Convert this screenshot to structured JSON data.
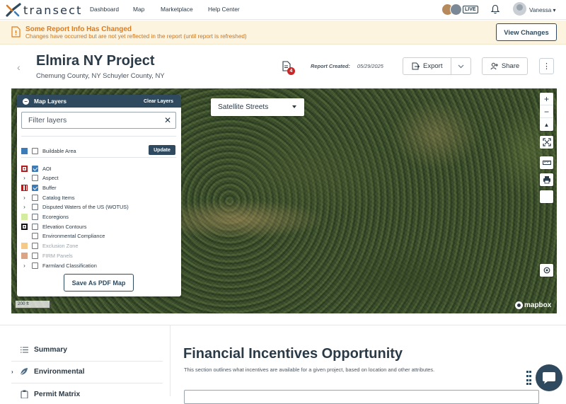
{
  "app": {
    "logo_text": "transect",
    "nav": [
      "Dashboard",
      "Map",
      "Marketplace",
      "Help Center"
    ],
    "live_label": "LIVE",
    "user_name": "Vanessa",
    "user_caret": "▾"
  },
  "banner": {
    "title": "Some Report Info Has Changed",
    "subtitle": "Changes have occurred but are not yet reflected in the report (until report is refreshed)",
    "button": "View Changes",
    "color": "#e07b1a"
  },
  "project": {
    "title": "Elmira NY Project",
    "counties": "Chemung County, NY Schuyler County, NY",
    "doc_badge": "4",
    "report_created_label": "Report Created:",
    "report_created_date": "05/29/2025",
    "export_label": "Export",
    "share_label": "Share",
    "more_label": "⋮"
  },
  "map": {
    "panel_title": "Map Layers",
    "clear_layers": "Clear Layers",
    "filter_placeholder": "Filter layers",
    "buildable_area": "Buildable Area",
    "update_label": "Update",
    "layers": [
      {
        "label": "AOI",
        "checked": true,
        "expandable": false,
        "swatch": "aoi",
        "faded": false
      },
      {
        "label": "Aspect",
        "checked": false,
        "expandable": true,
        "swatch": "",
        "faded": false
      },
      {
        "label": "Buffer",
        "checked": true,
        "expandable": false,
        "swatch": "buffer",
        "faded": false
      },
      {
        "label": "Catalog Items",
        "checked": false,
        "expandable": true,
        "swatch": "",
        "faded": false
      },
      {
        "label": "Disputed Waters of the US (WOTUS)",
        "checked": false,
        "expandable": true,
        "swatch": "",
        "faded": false
      },
      {
        "label": "Ecoregions",
        "checked": false,
        "expandable": false,
        "swatch": "eco",
        "faded": false
      },
      {
        "label": "Elevation Contours",
        "checked": false,
        "expandable": false,
        "swatch": "elev",
        "faded": false
      },
      {
        "label": "Environmental Compliance",
        "checked": false,
        "expandable": false,
        "swatch": "",
        "faded": false
      },
      {
        "label": "Exclusion Zone",
        "checked": false,
        "expandable": false,
        "swatch": "excl",
        "faded": true
      },
      {
        "label": "FIRM Panels",
        "checked": false,
        "expandable": false,
        "swatch": "firm",
        "faded": true
      },
      {
        "label": "Farmland Classification",
        "checked": false,
        "expandable": true,
        "swatch": "",
        "faded": false
      }
    ],
    "save_pdf": "Save As PDF Map",
    "style_select": "Satellite Streets",
    "scale_label": "200 ft",
    "attribution": "mapbox",
    "zoom_in": "+",
    "zoom_out": "−",
    "compass": "▲"
  },
  "sidebar": {
    "items": [
      {
        "label": "Summary",
        "icon": "list-icon",
        "expandable": false
      },
      {
        "label": "Environmental",
        "icon": "leaf-icon",
        "expandable": true
      },
      {
        "label": "Permit Matrix",
        "icon": "clipboard-icon",
        "expandable": false
      }
    ]
  },
  "section": {
    "title": "Financial Incentives Opportunity",
    "description": "This section outlines what incentives are available for a given project, based on location and other attributes."
  },
  "colors": {
    "primary": "#2f4a5e",
    "banner_bg": "#fdf4e0",
    "badge_red": "#c62828",
    "check_blue": "#3a7bb8"
  }
}
